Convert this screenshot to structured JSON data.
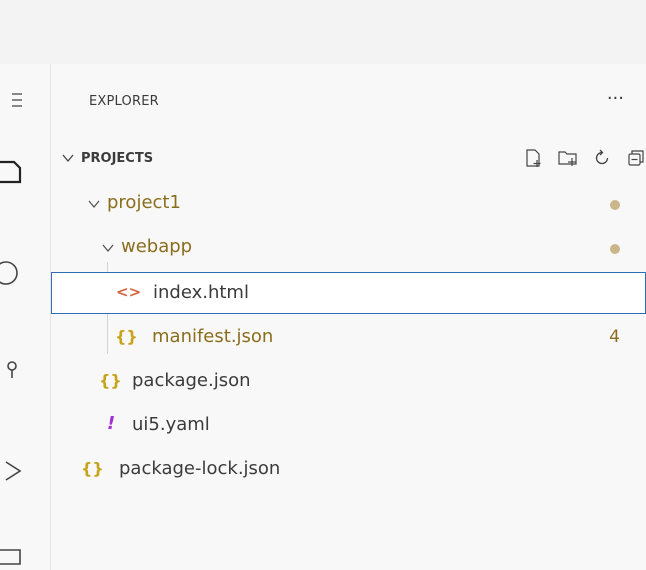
{
  "colors": {
    "accent_border": "#2f6fb6",
    "modified_text": "#8a6d1d",
    "json_icon": "#c7a41c",
    "html_icon": "#d4643c",
    "yaml_icon": "#a033cc",
    "dot": "#c9b68a"
  },
  "explorer": {
    "title": "EXPLORER",
    "more_label": "···"
  },
  "section": {
    "title": "PROJECTS",
    "actions": [
      "new-file-icon",
      "new-folder-icon",
      "refresh-icon",
      "collapse-all-icon"
    ]
  },
  "tree": [
    {
      "label": "project1",
      "type": "folder",
      "expanded": true,
      "modified": true
    },
    {
      "label": "webapp",
      "type": "folder",
      "expanded": true,
      "modified": true
    },
    {
      "label": "index.html",
      "type": "html",
      "selected": true
    },
    {
      "label": "manifest.json",
      "type": "json",
      "modified": true,
      "badge": "4"
    },
    {
      "label": "package.json",
      "type": "json"
    },
    {
      "label": "ui5.yaml",
      "type": "yaml"
    },
    {
      "label": "package-lock.json",
      "type": "json"
    }
  ],
  "file_icons": {
    "html": "<>",
    "json": "{}",
    "yaml": "!"
  }
}
